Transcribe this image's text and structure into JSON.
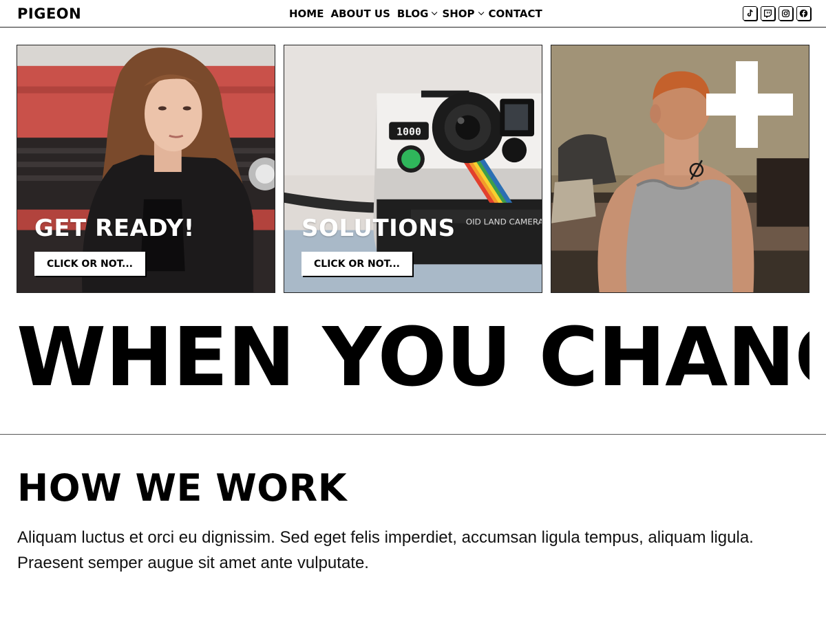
{
  "site": {
    "logo": "PIGEON"
  },
  "nav": [
    {
      "label": "HOME",
      "has_dropdown": false
    },
    {
      "label": "ABOUT US",
      "has_dropdown": false
    },
    {
      "label": "BLOG",
      "has_dropdown": true
    },
    {
      "label": "SHOP",
      "has_dropdown": true
    },
    {
      "label": "CONTACT",
      "has_dropdown": false
    }
  ],
  "socials": [
    {
      "icon": "tiktok-icon"
    },
    {
      "icon": "twitch-icon"
    },
    {
      "icon": "instagram-icon"
    },
    {
      "icon": "facebook-icon"
    }
  ],
  "cards": [
    {
      "title": "GET READY!",
      "button": "CLICK OR NOT...",
      "image": "woman-leather-jacket-red-car"
    },
    {
      "title": "SOLUTIONS",
      "button": "CLICK OR NOT...",
      "image": "polaroid-land-camera"
    },
    {
      "title": "",
      "button": "",
      "image": "man-tank-top-back-with-plus-sign"
    }
  ],
  "marquee": {
    "text": "WHEN YOU CHANGE"
  },
  "how_we_work": {
    "title": "HOW WE WORK",
    "body": "Aliquam luctus et orci eu dignissim. Sed eget felis imperdiet, accumsan ligula tempus, aliquam ligula. Praesent semper augue sit amet ante vulputate."
  },
  "colors": {
    "accent": "#000000",
    "background": "#ffffff",
    "text": "#000000"
  }
}
